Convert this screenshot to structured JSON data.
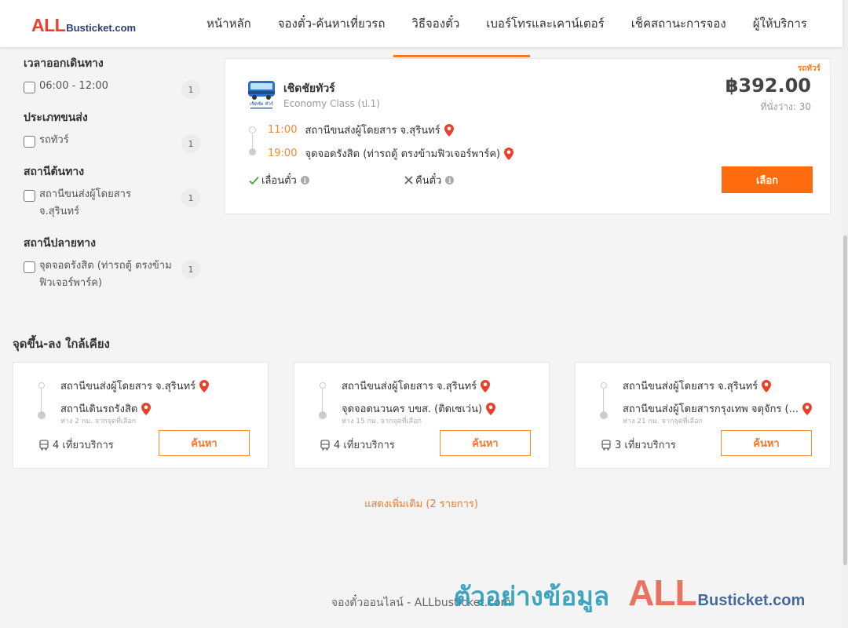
{
  "header": {
    "logo_all": "ALL",
    "logo_rest": "Busticket.com",
    "nav": [
      "หน้าหลัก",
      "จองตั๋ว-ค้นหาเที่ยวรถ",
      "วิธีจองตั๋ว",
      "เบอร์โทรและเคาน์เตอร์",
      "เช็คสถานะการจอง",
      "ผู้ให้บริการ"
    ]
  },
  "filters": {
    "time": {
      "title": "เวลาออกเดินทาง",
      "option": "06:00 - 12:00",
      "count": "1"
    },
    "transport": {
      "title": "ประเภทขนส่ง",
      "option": "รถทัวร์",
      "count": "1"
    },
    "origin": {
      "title": "สถานีต้นทาง",
      "option": "สถานีขนส่งผู้โดยสาร จ.สุรินทร์",
      "count": "1"
    },
    "destination": {
      "title": "สถานีปลายทาง",
      "option": "จุดจอดรังสิต (ท่ารถตู้ ตรงข้ามฟิวเจอร์พาร์ค)",
      "count": "1"
    }
  },
  "trip": {
    "bus_type": "รถทัวร์",
    "operator": "เชิดชัยทัวร์",
    "logo_text": "เชิดชัย ทัวร์",
    "class": "Economy Class (ป.1)",
    "price": "฿392.00",
    "seats": "ที่นั่งว่าง: 30",
    "depart_time": "11:00",
    "depart_station": "สถานีขนส่งผู้โดยสาร จ.สุรินทร์",
    "arrive_time": "19:00",
    "arrive_station": "จุดจอดรังสิต (ท่ารถตู้ ตรงข้ามฟิวเจอร์พาร์ค)",
    "reschedule": "เลื่อนตั๋ว",
    "refund": "คืนตั๋ว",
    "select_label": "เลือก"
  },
  "nearby": {
    "title": "จุดขึ้น-ลง ใกล้เคียง",
    "cards": [
      {
        "from": "สถานีขนส่งผู้โดยสาร จ.สุรินทร์",
        "to": "สถานีเดินรถรังสิต",
        "distance": "ห่าง 2 กม. จากจุดที่เลือก",
        "trips": "4 เที่ยวบริการ",
        "button": "ค้นหา"
      },
      {
        "from": "สถานีขนส่งผู้โดยสาร จ.สุรินทร์",
        "to": "จุดจอดนวนคร บขส. (ติดเซเว่น)",
        "distance": "ห่าง 15 กม. จากจุดที่เลือก",
        "trips": "4 เที่ยวบริการ",
        "button": "ค้นหา"
      },
      {
        "from": "สถานีขนส่งผู้โดยสาร จ.สุรินทร์",
        "to": "สถานีขนส่งผู้โดยสารกรุงเทพ จตุจักร (...",
        "distance": "ห่าง 21 กม. จากจุดที่เลือก",
        "trips": "3 เที่ยวบริการ",
        "button": "ค้นหา"
      }
    ],
    "more": "แสดงเพิ่มเติม (2 รายการ)"
  },
  "footer": "จองตั๋วออนไลน์ - ALLbusticket.com",
  "watermark": {
    "thai": "ตัวอย่างข้อมูล",
    "all": "ALL",
    "rest": "Busticket.com"
  },
  "colors": {
    "accent": "#ff6b0f",
    "pin": "#e8412c",
    "check": "#4caf50"
  }
}
